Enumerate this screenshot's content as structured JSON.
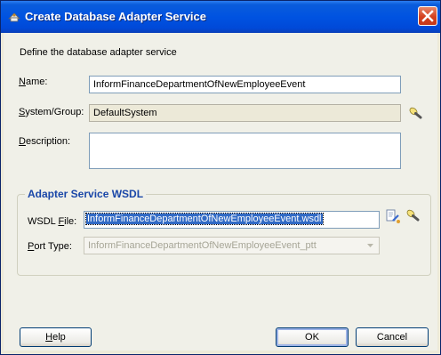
{
  "window": {
    "title": "Create Database Adapter Service"
  },
  "heading": "Define the database adapter service",
  "fields": {
    "name": {
      "label_mnemonic": "N",
      "label_rest": "ame:",
      "value": "InformFinanceDepartmentOfNewEmployeeEvent"
    },
    "system_group": {
      "label_mnemonic": "S",
      "label_rest": "ystem/Group:",
      "value": "DefaultSystem"
    },
    "description": {
      "label_mnemonic": "D",
      "label_rest": "escription:",
      "value": ""
    }
  },
  "wsdl_group": {
    "title": "Adapter Service WSDL",
    "wsdl_file": {
      "label_pre": "WSDL ",
      "label_mnemonic": "F",
      "label_rest": "ile:",
      "value": "InformFinanceDepartmentOfNewEmployeeEvent.wsdl"
    },
    "port_type": {
      "label_mnemonic": "P",
      "label_rest": "ort Type:",
      "value": "InformFinanceDepartmentOfNewEmployeeEvent_ptt"
    }
  },
  "buttons": {
    "help": {
      "mnemonic": "H",
      "rest": "elp"
    },
    "ok": "OK",
    "cancel": "Cancel"
  },
  "icons": {
    "title": "database-adapter-icon",
    "close": "close-icon",
    "browse": "flashlight-icon",
    "edit_wsdl": "wsdl-edit-icon"
  },
  "colors": {
    "title_bar": "#0053e1",
    "group_title": "#1a47a8",
    "selection": "#316ac5"
  }
}
